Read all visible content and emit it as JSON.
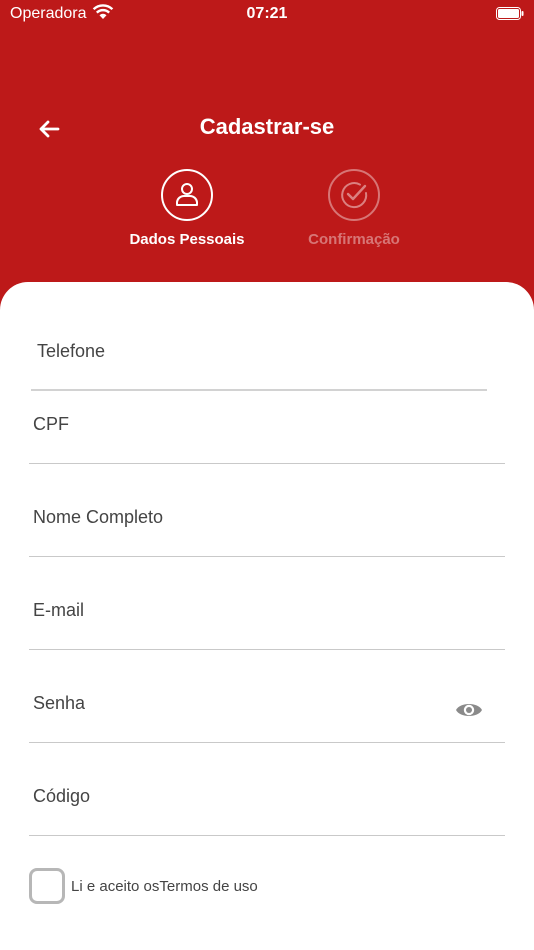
{
  "status_bar": {
    "carrier": "Operadora",
    "time": "07:21"
  },
  "header": {
    "title": "Cadastrar-se"
  },
  "steps": [
    {
      "label": "Dados Pessoais",
      "state": "active"
    },
    {
      "label": "Confirmação",
      "state": "inactive"
    }
  ],
  "form": {
    "telefone_label": "Telefone",
    "cpf_label": "CPF",
    "nome_label": "Nome Completo",
    "email_label": "E-mail",
    "senha_label": "Senha",
    "codigo_label": "Código"
  },
  "terms": {
    "prefix": "Li e aceito os",
    "link": "Termos de uso",
    "checked": false
  },
  "colors": {
    "brand": "#bd1919",
    "text": "#444444",
    "divider": "#c9c9c9"
  },
  "icons": [
    "back-arrow-icon",
    "user-icon",
    "check-circle-icon",
    "eye-icon",
    "wifi-icon",
    "battery-icon"
  ]
}
